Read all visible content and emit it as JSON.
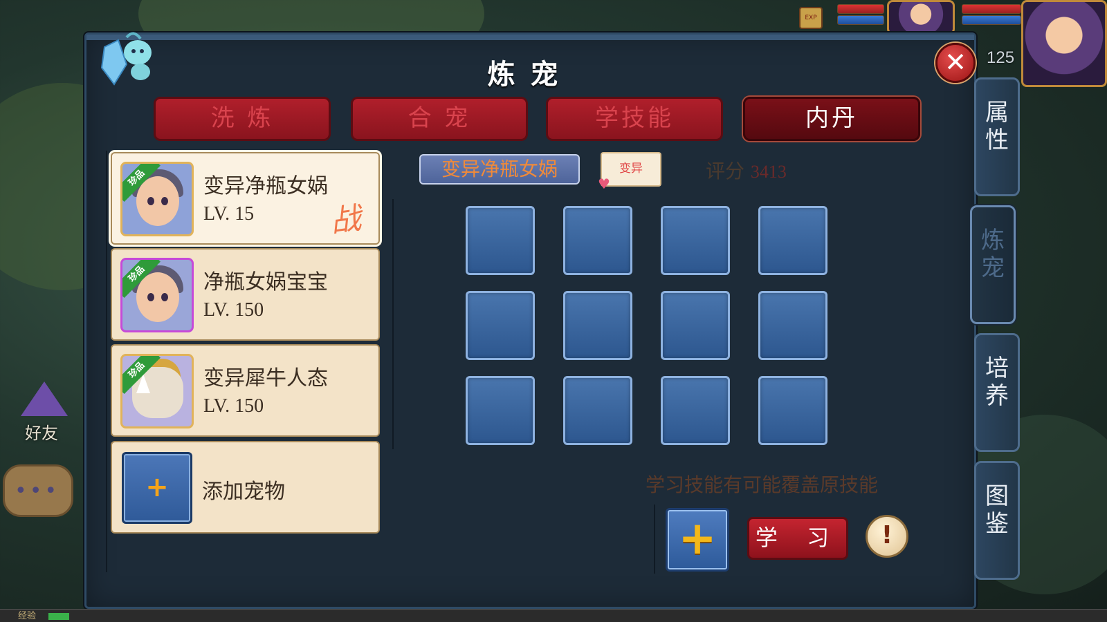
{
  "hud": {
    "player_level": "125",
    "exp_icon_label": "EXP"
  },
  "side_left": {
    "friends_label": "好友",
    "chat_dots": "•••"
  },
  "exp_bar": {
    "label": "经验",
    "progress": 0.02
  },
  "panel": {
    "title": "炼宠",
    "close_label": "✕"
  },
  "tabs": [
    {
      "label": "洗 炼",
      "active": false
    },
    {
      "label": "合 宠",
      "active": false
    },
    {
      "label": "学技能",
      "active": false
    },
    {
      "label": "内丹",
      "active": true
    }
  ],
  "pets": [
    {
      "name": "变异净瓶女娲",
      "level": "LV. 15",
      "quality": "珍品",
      "battle_mark": "战",
      "selected": true,
      "avatar": "nuwa"
    },
    {
      "name": "净瓶女娲宝宝",
      "level": "LV. 150",
      "quality": "珍品",
      "selected": false,
      "avatar": "nuwa"
    },
    {
      "name": "变异犀牛人态",
      "level": "LV. 150",
      "quality": "珍品",
      "selected": false,
      "avatar": "rhino"
    }
  ],
  "add_pet": {
    "label": "添加宠物",
    "icon": "plus-icon",
    "plus": "+"
  },
  "selected_pet": {
    "name": "变异净瓶女娲",
    "variant_tag": "变异",
    "score_label": "评分",
    "score_value": "3413"
  },
  "skill_slots": {
    "rows": 3,
    "cols": 4,
    "count": 12
  },
  "hint": "学习技能有可能覆盖原技能",
  "actions": {
    "add_skill": "+",
    "learn": "学 习",
    "info": "!"
  },
  "side_tabs": [
    {
      "label": "属\n性",
      "active": false
    },
    {
      "label": "炼\n宠",
      "active": true
    },
    {
      "label": "培\n养",
      "active": false
    },
    {
      "label": "图\n鉴",
      "active": false
    }
  ],
  "colors": {
    "panel_bg": "#1d2b38",
    "tab_red": "#b01f2b",
    "card_cream": "#f3e3c8",
    "slot_blue": "#3f6aa6",
    "accent_orange": "#f08a3a"
  }
}
